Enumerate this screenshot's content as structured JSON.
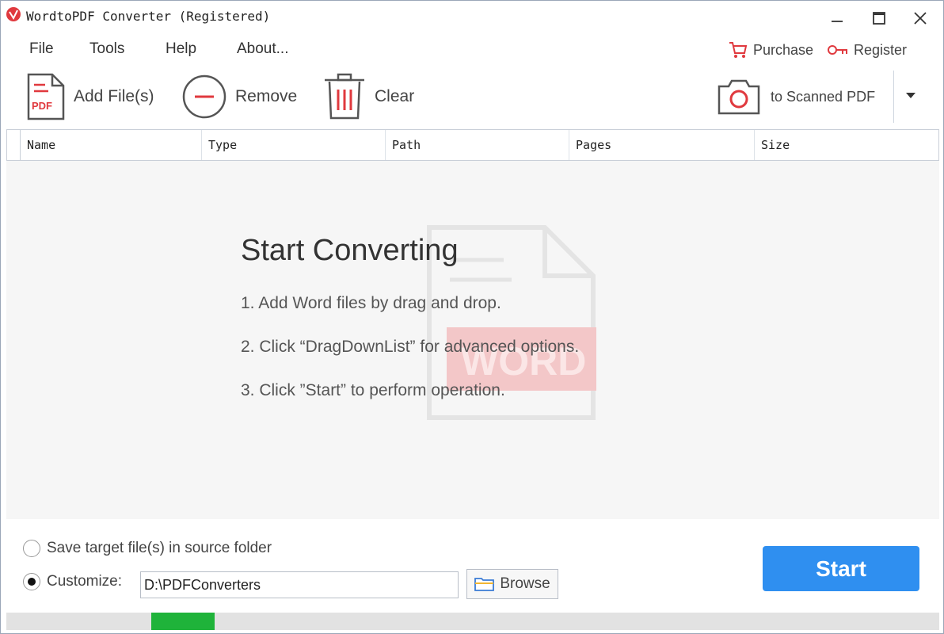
{
  "window": {
    "title": "WordtoPDF Converter (Registered)"
  },
  "menu": {
    "file": "File",
    "tools": "Tools",
    "help": "Help",
    "about": "About..."
  },
  "topright": {
    "purchase": "Purchase",
    "register": "Register"
  },
  "toolbar": {
    "add": "Add File(s)",
    "remove": "Remove",
    "clear": "Clear",
    "scan": "to Scanned PDF",
    "add_icon_text": "PDF"
  },
  "table": {
    "columns": [
      "Name",
      "Type",
      "Path",
      "Pages",
      "Size"
    ]
  },
  "guide": {
    "title": "Start Converting",
    "steps": [
      "1. Add Word files by drag and drop.",
      "2. Click “DragDownList” for advanced options.",
      "3. Click ”Start” to perform operation."
    ],
    "watermark_text": "WORD"
  },
  "output": {
    "option_source": "Save target file(s) in source folder",
    "option_customize": "Customize:",
    "selected": "customize",
    "path": "D:\\PDFConverters",
    "browse": "Browse"
  },
  "start_label": "Start",
  "progress": {
    "segment_start": 0.155,
    "segment_end": 0.223
  },
  "colors": {
    "accent_red": "#e0393e",
    "start_blue": "#2f8ff0",
    "progress_green": "#1fb33a"
  }
}
